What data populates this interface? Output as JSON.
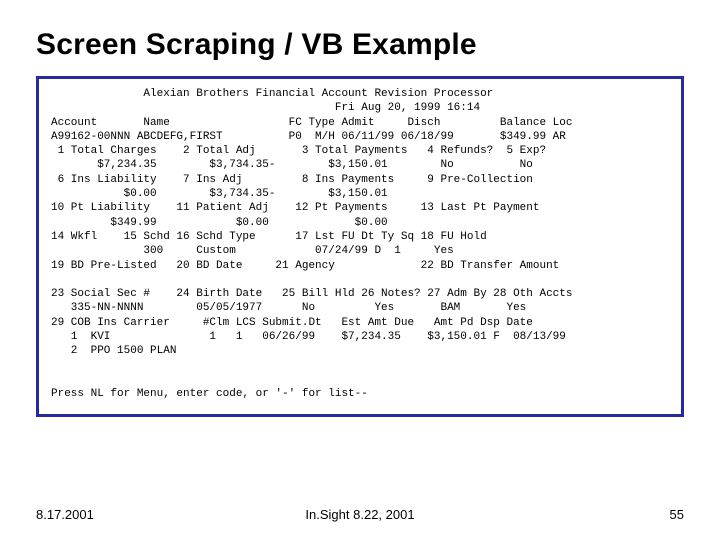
{
  "title": "Screen Scraping / VB Example",
  "term": {
    "l1": "              Alexian Brothers Financial Account Revision Processor",
    "l2": "                                           Fri Aug 20, 1999 16:14",
    "l3": "Account       Name                  FC Type Admit     Disch         Balance Loc",
    "l4": "A99162-00NNN ABCDEFG,FIRST          P0  M/H 06/11/99 06/18/99       $349.99 AR",
    "l5": " 1 Total Charges    2 Total Adj       3 Total Payments   4 Refunds?  5 Exp?",
    "l6": "       $7,234.35        $3,734.35-        $3,150.01        No          No",
    "l7": " 6 Ins Liability    7 Ins Adj         8 Ins Payments     9 Pre-Collection",
    "l8": "           $0.00        $3,734.35-        $3,150.01",
    "l9": "10 Pt Liability    11 Patient Adj    12 Pt Payments     13 Last Pt Payment",
    "l10": "         $349.99            $0.00             $0.00",
    "l11": "14 Wkfl    15 Schd 16 Schd Type      17 Lst FU Dt Ty Sq 18 FU Hold",
    "l12": "              300     Custom            07/24/99 D  1     Yes",
    "l13": "19 BD Pre-Listed   20 BD Date     21 Agency             22 BD Transfer Amount",
    "l14": "",
    "l15": "23 Social Sec #    24 Birth Date   25 Bill Hld 26 Notes? 27 Adm By 28 Oth Accts",
    "l16": "   335-NN-NNNN        05/05/1977      No         Yes       BAM       Yes",
    "l17": "29 COB Ins Carrier     #Clm LCS Submit.Dt   Est Amt Due   Amt Pd Dsp Date",
    "l18": "   1  KVI               1   1   06/26/99    $7,234.35    $3,150.01 F  08/13/99",
    "l19": "   2  PPO 1500 PLAN",
    "l20": "",
    "l21": "",
    "l22": "Press NL for Menu, enter code, or '-' for list--"
  },
  "footer": {
    "left": "8.17.2001",
    "center": "In.Sight 8.22, 2001",
    "right": "55"
  }
}
